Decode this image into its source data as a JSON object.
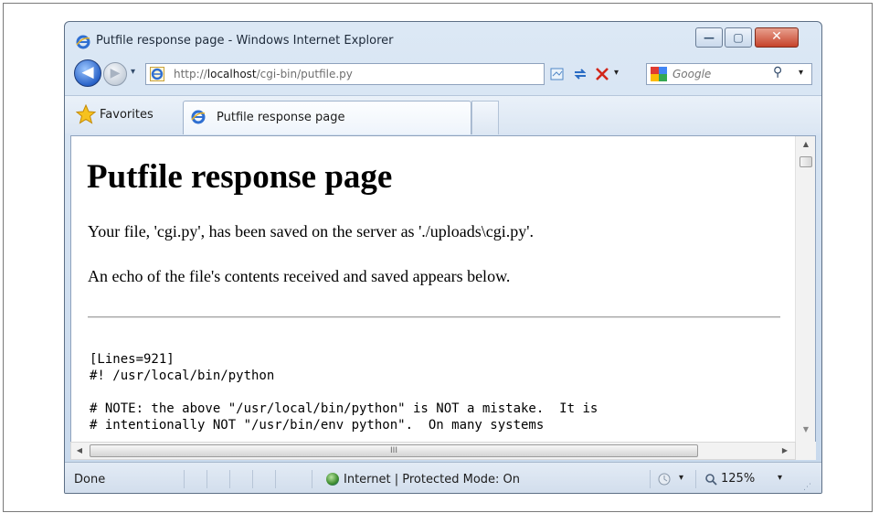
{
  "window": {
    "title": "Putfile response page - Windows Internet Explorer",
    "minimize_glyph": "—",
    "maximize_glyph": "▢",
    "close_glyph": "✕"
  },
  "nav": {
    "back_glyph": "◀",
    "forward_glyph": "▶",
    "dropdown_glyph": "▾",
    "address_prefix": "http://",
    "address_host": "localhost",
    "address_path": "/cgi-bin/putfile.py",
    "search_placeholder": "Google",
    "search_glyph": "⚲"
  },
  "tabs": {
    "favorites_label": "Favorites",
    "active_tab_label": "Putfile response page"
  },
  "page": {
    "heading": "Putfile response page",
    "saved_msg": "Your file, 'cgi.py', has been saved on the server as './uploads\\cgi.py'.",
    "echo_msg": "An echo of the file's contents received and saved appears below.",
    "code_lines": [
      "[Lines=921]",
      "#! /usr/local/bin/python",
      "# NOTE: the above \"/usr/local/bin/python\" is NOT a mistake.  It is",
      "# intentionally NOT \"/usr/bin/env python\".  On many systems"
    ]
  },
  "scrollbars": {
    "up_glyph": "▲",
    "down_glyph": "▼",
    "left_glyph": "◀",
    "right_glyph": "▶",
    "grip_glyph": "III",
    "vgrip_glyph": "≡"
  },
  "status": {
    "text": "Done",
    "zone": "Internet | Protected Mode: On",
    "zoom": "125%",
    "dropdown_glyph": "▾"
  },
  "colors": {
    "frame": "#dce8f5",
    "close_button": "#c6432a",
    "back_button": "#2a63c8"
  },
  "icons": [
    "ie-icon",
    "compat-view-icon",
    "refresh-icon",
    "stop-icon",
    "google-icon",
    "search-icon",
    "favorites-star-icon",
    "globe-icon",
    "security-icon",
    "zoom-icon"
  ]
}
